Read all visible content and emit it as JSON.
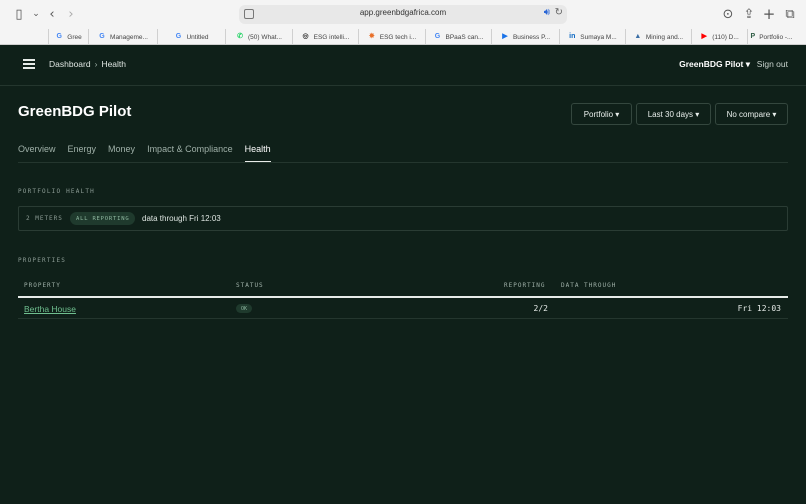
{
  "browser": {
    "url": "app.greenbdgafrica.com",
    "tabs": [
      {
        "label": "Gree",
        "icon": "google-icon",
        "color": "#4285f4",
        "glyph": "G"
      },
      {
        "label": "Manageme...",
        "icon": "google-icon",
        "color": "#4285f4",
        "glyph": "G"
      },
      {
        "label": "Untitled",
        "icon": "google-icon",
        "color": "#4285f4",
        "glyph": "G"
      },
      {
        "label": "(50) What...",
        "icon": "whatsapp-icon",
        "color": "#25d366",
        "glyph": "✆"
      },
      {
        "label": "ESG intelli...",
        "icon": "globe-icon",
        "color": "#333333",
        "glyph": "◎"
      },
      {
        "label": "ESG tech i...",
        "icon": "star-icon",
        "color": "#e8702a",
        "glyph": "✸"
      },
      {
        "label": "BPaaS can...",
        "icon": "google-icon",
        "color": "#4285f4",
        "glyph": "G"
      },
      {
        "label": "Business P...",
        "icon": "play-icon",
        "color": "#1a73e8",
        "glyph": "▶"
      },
      {
        "label": "Sumaya M...",
        "icon": "linkedin-icon",
        "color": "#0a66c2",
        "glyph": "in"
      },
      {
        "label": "Mining and...",
        "icon": "mountain-icon",
        "color": "#3b6ea5",
        "glyph": "▲"
      },
      {
        "label": "(110) D...",
        "icon": "youtube-icon",
        "color": "#ff0000",
        "glyph": "▶"
      },
      {
        "label": "Portfolio -...",
        "icon": "portfolio-icon",
        "color": "#2f5d45",
        "glyph": "P"
      }
    ]
  },
  "header": {
    "breadcrumb_root": "Dashboard",
    "breadcrumb_sep": "›",
    "breadcrumb_current": "Health",
    "account": "GreenBDG Pilot ▾",
    "signout": "Sign out"
  },
  "page": {
    "title": "GreenBDG Pilot",
    "controls": {
      "portfolio": "Portfolio ▾",
      "range": "Last 30 days ▾",
      "compare": "No compare ▾"
    }
  },
  "nav": [
    {
      "label": "Overview",
      "active": false
    },
    {
      "label": "Energy",
      "active": false
    },
    {
      "label": "Money",
      "active": false
    },
    {
      "label": "Impact & Compliance",
      "active": false
    },
    {
      "label": "Health",
      "active": true
    }
  ],
  "health": {
    "section_label": "PORTFOLIO HEALTH",
    "meters": "2 METERS",
    "badge": "ALL REPORTING",
    "through": "data through Fri 12:03"
  },
  "properties": {
    "section_label": "PROPERTIES",
    "columns": {
      "property": "PROPERTY",
      "status": "STATUS",
      "reporting": "REPORTING",
      "data_through": "DATA THROUGH"
    },
    "rows": [
      {
        "property": "Bertha House",
        "status": "OK",
        "reporting": "2/2",
        "data_through": "Fri 12:03"
      }
    ]
  },
  "colors": {
    "background": "#0f2019",
    "accent": "#6fbf8f",
    "badge_bg": "#1f3a2d"
  }
}
